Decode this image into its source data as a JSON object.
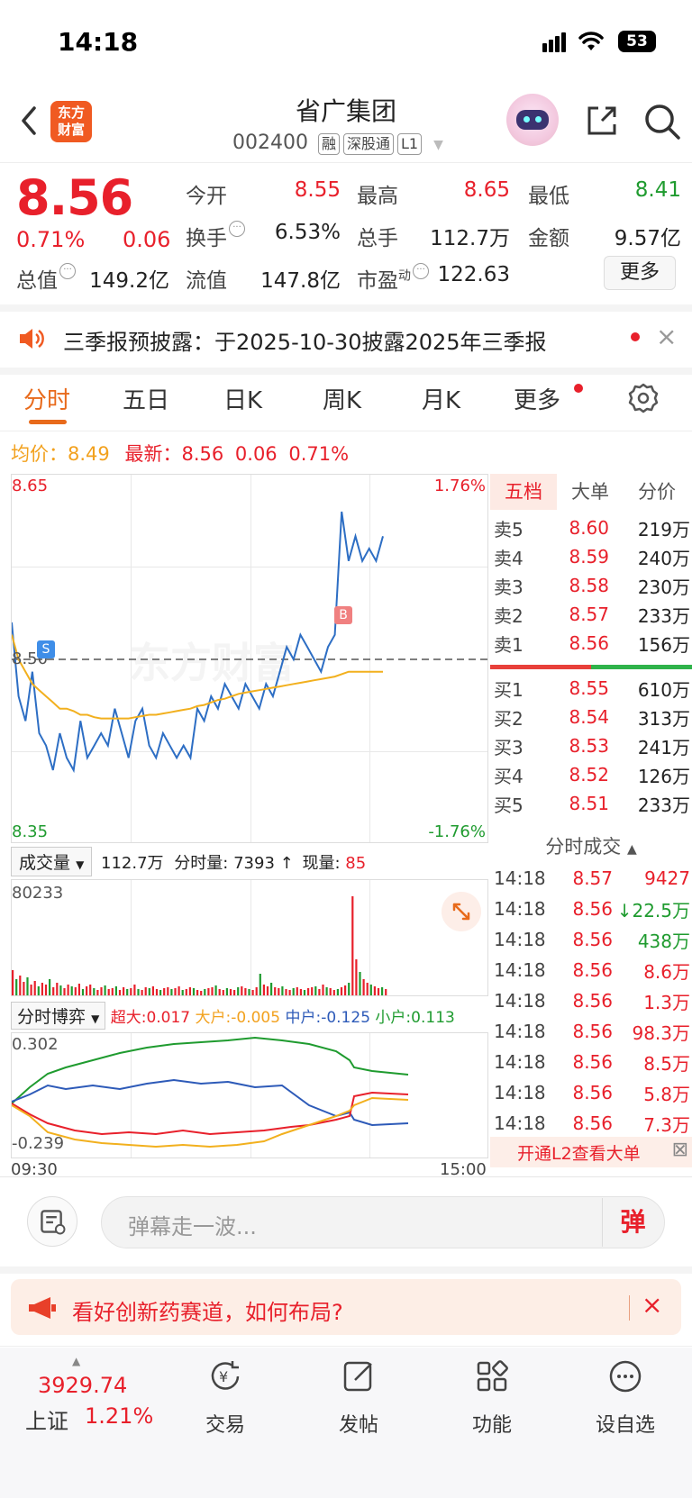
{
  "status": {
    "time": "14:18",
    "battery": "53"
  },
  "header": {
    "logo_line1": "东方",
    "logo_line2": "财富",
    "name": "省广集团",
    "code": "002400",
    "tags": [
      "融",
      "深股通",
      "L1"
    ]
  },
  "quote": {
    "price": "8.56",
    "change_pct": "0.71%",
    "change_amt": "0.06",
    "open_label": "今开",
    "open": "8.55",
    "high_label": "最高",
    "high": "8.65",
    "low_label": "最低",
    "low": "8.41",
    "turnover_label": "换手",
    "turnover": "6.53%",
    "volume_label": "总手",
    "volume": "112.7万",
    "amount_label": "金额",
    "amount": "9.57亿",
    "mcap_label": "总值",
    "mcap": "149.2亿",
    "float_label": "流值",
    "float": "147.8亿",
    "pe_label": "市盈",
    "pe_sup": "动",
    "pe": "122.63",
    "more": "更多"
  },
  "notice": {
    "text": "三季报预披露：于2025-10-30披露2025年三季报"
  },
  "tabs": [
    "分时",
    "五日",
    "日K",
    "周K",
    "月K",
    "更多"
  ],
  "avgbar": {
    "avg_label": "均价：",
    "avg": "8.49",
    "last_label": "最新：",
    "last": "8.56",
    "chg": "0.06",
    "pct": "0.71%"
  },
  "chart": {
    "y_top": "8.65",
    "y_mid": "8.50",
    "y_bottom": "8.35",
    "pct_top": "1.76%",
    "pct_bottom": "-1.76%",
    "watermark": "东方财富",
    "marker_s": "S",
    "marker_b": "B",
    "colors": {
      "price": "#2d6ec4",
      "avg": "#f2b01e",
      "up": "#e8202b",
      "down": "#1f9b2f"
    }
  },
  "orderbook": {
    "tabs": [
      "五档",
      "大单",
      "分价"
    ],
    "asks": [
      {
        "label": "卖5",
        "price": "8.60",
        "vol": "219万"
      },
      {
        "label": "卖4",
        "price": "8.59",
        "vol": "240万"
      },
      {
        "label": "卖3",
        "price": "8.58",
        "vol": "230万"
      },
      {
        "label": "卖2",
        "price": "8.57",
        "vol": "233万"
      },
      {
        "label": "卖1",
        "price": "8.56",
        "vol": "156万"
      }
    ],
    "bids": [
      {
        "label": "买1",
        "price": "8.55",
        "vol": "610万"
      },
      {
        "label": "买2",
        "price": "8.54",
        "vol": "313万"
      },
      {
        "label": "买3",
        "price": "8.53",
        "vol": "241万"
      },
      {
        "label": "买4",
        "price": "8.52",
        "vol": "126万"
      },
      {
        "label": "买5",
        "price": "8.51",
        "vol": "233万"
      }
    ]
  },
  "volume": {
    "selector": "成交量",
    "total": "112.7万",
    "fs_label": "分时量:",
    "fs_val": "7393",
    "now_label": "现量:",
    "now_val": "85",
    "max": "80233"
  },
  "game": {
    "selector": "分时博弈",
    "super_label": "超大:",
    "super": "0.017",
    "big_label": "大户:",
    "big": "-0.005",
    "mid_label": "中户:",
    "mid": "-0.125",
    "small_label": "小户:",
    "small": "0.113",
    "y_top": "0.302",
    "y_bottom": "-0.239",
    "t_start": "09:30",
    "t_end": "15:00"
  },
  "ticks": {
    "title": "分时成交",
    "rows": [
      {
        "t": "14:18",
        "p": "8.57",
        "v": "9427",
        "pc": "red",
        "vc": "red",
        "arrow": ""
      },
      {
        "t": "14:18",
        "p": "8.56",
        "v": "22.5万",
        "pc": "red",
        "vc": "green",
        "arrow": "↓"
      },
      {
        "t": "14:18",
        "p": "8.56",
        "v": "438万",
        "pc": "red",
        "vc": "green",
        "arrow": ""
      },
      {
        "t": "14:18",
        "p": "8.56",
        "v": "8.6万",
        "pc": "red",
        "vc": "red",
        "arrow": ""
      },
      {
        "t": "14:18",
        "p": "8.56",
        "v": "1.3万",
        "pc": "red",
        "vc": "red",
        "arrow": ""
      },
      {
        "t": "14:18",
        "p": "8.56",
        "v": "98.3万",
        "pc": "red",
        "vc": "red",
        "arrow": ""
      },
      {
        "t": "14:18",
        "p": "8.56",
        "v": "8.5万",
        "pc": "red",
        "vc": "red",
        "arrow": ""
      },
      {
        "t": "14:18",
        "p": "8.56",
        "v": "5.8万",
        "pc": "red",
        "vc": "red",
        "arrow": ""
      },
      {
        "t": "14:18",
        "p": "8.56",
        "v": "7.3万",
        "pc": "red",
        "vc": "red",
        "arrow": ""
      }
    ],
    "l2": "开通L2查看大单"
  },
  "danmu": {
    "placeholder": "弹幕走一波...",
    "button": "弹"
  },
  "ad": {
    "text": "看好创新药赛道，如何布局?"
  },
  "tabbar": {
    "index_value": "3929.74",
    "index_name": "上证",
    "index_pct": "1.21%",
    "items": [
      "交易",
      "发帖",
      "功能",
      "设自选"
    ]
  },
  "chart_data": {
    "type": "line",
    "price_range": [
      8.35,
      8.65
    ],
    "prev_close": 8.5,
    "series": [
      {
        "values": [
          8.53,
          8.47,
          8.45,
          8.49,
          8.44,
          8.43,
          8.41,
          8.44,
          8.42,
          8.41,
          8.45,
          8.42,
          8.43,
          8.44,
          8.43,
          8.46,
          8.44,
          8.42,
          8.45,
          8.46,
          8.43,
          8.42,
          8.44,
          8.43,
          8.42,
          8.43,
          8.42,
          8.46,
          8.45,
          8.47,
          8.46,
          8.48,
          8.47,
          8.46,
          8.48,
          8.47,
          8.46,
          8.48,
          8.47,
          8.49,
          8.51,
          8.5,
          8.52,
          8.51,
          8.5,
          8.49,
          8.51,
          8.52,
          8.62,
          8.58,
          8.6,
          8.58,
          8.59,
          8.58,
          8.6
        ]
      },
      {
        "values": [
          8.52,
          8.5,
          8.49,
          8.48,
          8.475,
          8.47,
          8.465,
          8.46,
          8.46,
          8.458,
          8.455,
          8.455,
          8.453,
          8.452,
          8.452,
          8.452,
          8.452,
          8.452,
          8.453,
          8.454,
          8.455,
          8.455,
          8.456,
          8.457,
          8.458,
          8.459,
          8.46,
          8.462,
          8.463,
          8.465,
          8.467,
          8.468,
          8.47,
          8.472,
          8.473,
          8.474,
          8.475,
          8.476,
          8.477,
          8.478,
          8.479,
          8.48,
          8.481,
          8.482,
          8.483,
          8.484,
          8.485,
          8.486,
          8.488,
          8.49,
          8.49,
          8.49,
          8.49,
          8.49,
          8.49
        ]
      }
    ]
  }
}
